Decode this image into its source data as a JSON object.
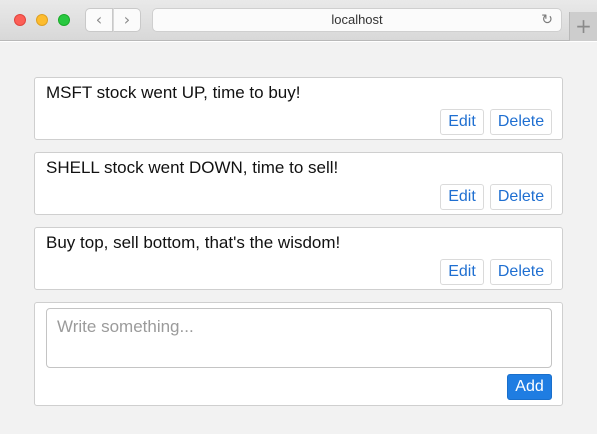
{
  "browser": {
    "address": "localhost",
    "back_glyph": "‹",
    "forward_glyph": "›",
    "reload_glyph": "↻",
    "newtab_glyph": "+"
  },
  "posts": [
    {
      "text": "MSFT stock went UP, time to buy!",
      "edit_label": "Edit",
      "delete_label": "Delete"
    },
    {
      "text": "SHELL stock went DOWN, time to sell!",
      "edit_label": "Edit",
      "delete_label": "Delete"
    },
    {
      "text": "Buy top, sell bottom, that's the wisdom!",
      "edit_label": "Edit",
      "delete_label": "Delete"
    }
  ],
  "composer": {
    "placeholder": "Write something...",
    "value": "",
    "add_label": "Add"
  },
  "colors": {
    "accent": "#1f7de2",
    "link": "#1f6fd1",
    "page_bg": "#f2f2f2"
  }
}
